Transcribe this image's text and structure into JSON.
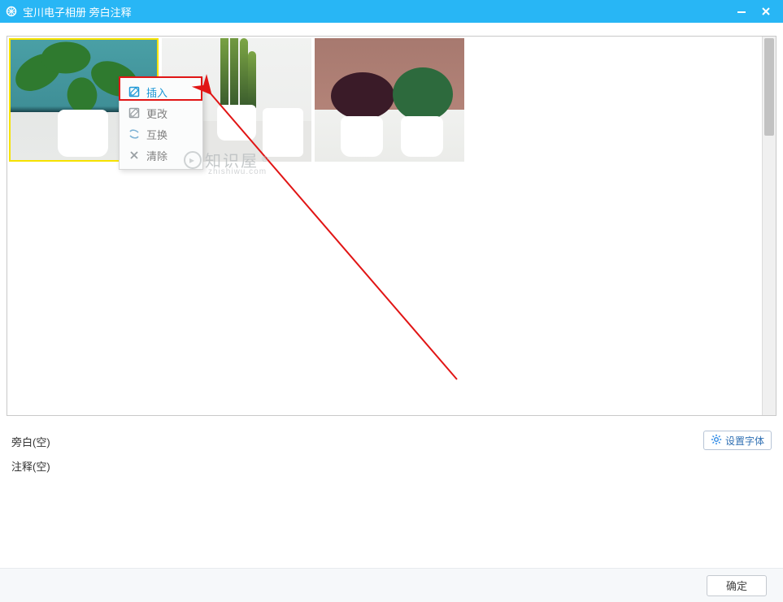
{
  "window": {
    "title": "宝川电子相册  旁白注释"
  },
  "context_menu": {
    "items": [
      {
        "label": "插入",
        "icon": "edit-insert-icon"
      },
      {
        "label": "更改",
        "icon": "edit-modify-icon"
      },
      {
        "label": "互换",
        "icon": "swap-icon"
      },
      {
        "label": "清除",
        "icon": "clear-icon"
      }
    ]
  },
  "fields": {
    "narration_label": "旁白(空)",
    "annotation_label": "注释(空)"
  },
  "buttons": {
    "set_font": "设置字体",
    "ok": "确定"
  },
  "watermark": {
    "main": "知识屋",
    "sup": "®",
    "sub": "zhishiwu.com"
  }
}
